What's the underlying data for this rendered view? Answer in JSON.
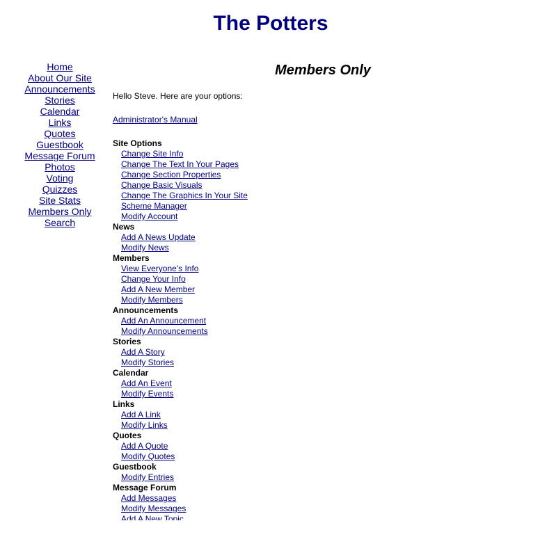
{
  "site": {
    "title": "The Potters"
  },
  "nav": {
    "items": [
      {
        "label": "Home"
      },
      {
        "label": "About Our Site"
      },
      {
        "label": "Announcements"
      },
      {
        "label": "Stories"
      },
      {
        "label": "Calendar"
      },
      {
        "label": "Links"
      },
      {
        "label": "Quotes"
      },
      {
        "label": "Guestbook"
      },
      {
        "label": "Message Forum"
      },
      {
        "label": "Photos"
      },
      {
        "label": "Voting"
      },
      {
        "label": "Quizzes"
      },
      {
        "label": "Site Stats"
      },
      {
        "label": "Members Only"
      },
      {
        "label": "Search"
      }
    ]
  },
  "main": {
    "page_title": "Members Only",
    "greeting": "Hello Steve. Here are your options:",
    "manual_link": "Administrator's Manual",
    "sections": [
      {
        "heading": "Site Options",
        "links": [
          "Change Site Info",
          "Change The Text In Your Pages",
          "Change Section Properties",
          "Change Basic Visuals",
          "Change The Graphics In Your Site",
          "Scheme Manager",
          "Modify Account"
        ]
      },
      {
        "heading": "News",
        "links": [
          "Add A News Update",
          "Modify News"
        ]
      },
      {
        "heading": "Members",
        "links": [
          "View Everyone's Info",
          "Change Your Info",
          "Add A New Member",
          "Modify Members"
        ]
      },
      {
        "heading": "Announcements",
        "links": [
          "Add An Announcement",
          "Modify Announcements"
        ]
      },
      {
        "heading": "Stories",
        "links": [
          "Add A Story",
          "Modify Stories"
        ]
      },
      {
        "heading": "Calendar",
        "links": [
          "Add An Event",
          "Modify Events"
        ]
      },
      {
        "heading": "Links",
        "links": [
          "Add A Link",
          "Modify Links"
        ]
      },
      {
        "heading": "Quotes",
        "links": [
          "Add A Quote",
          "Modify Quotes"
        ]
      },
      {
        "heading": "Guestbook",
        "links": [
          "Modify Entries"
        ]
      },
      {
        "heading": "Message Forum",
        "links": [
          "Add Messages",
          "Modify Messages",
          "Add A New Topic"
        ]
      }
    ]
  },
  "colors": {
    "title": "#000080",
    "link": "#000080",
    "text": "#000000",
    "background": "#ffffff"
  }
}
